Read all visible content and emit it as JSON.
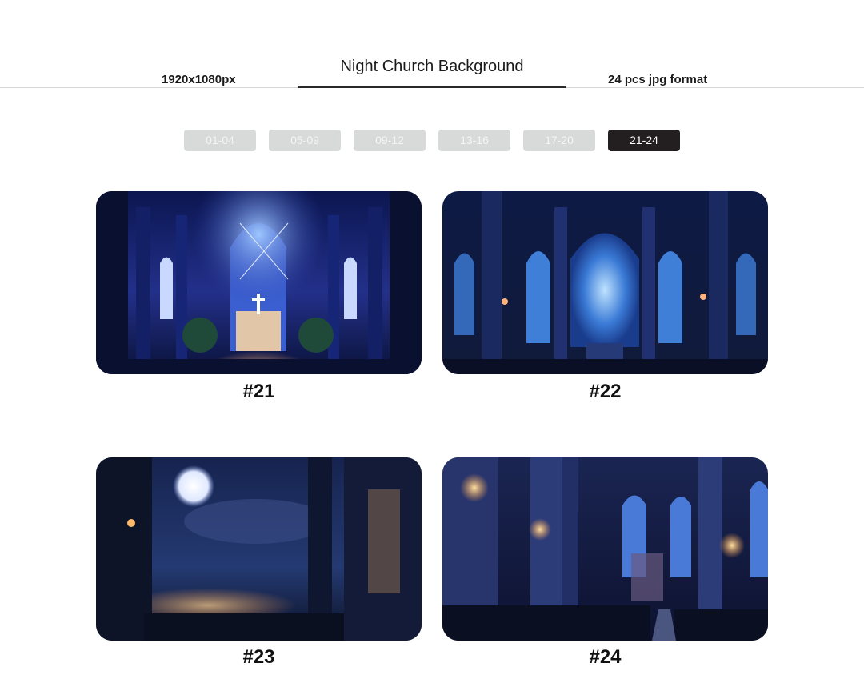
{
  "header": {
    "resolution": "1920x1080px",
    "title": "Night Church Background",
    "format": "24 pcs jpg format"
  },
  "tabs": [
    {
      "label": "01-04",
      "active": false
    },
    {
      "label": "05-09",
      "active": false
    },
    {
      "label": "09-12",
      "active": false
    },
    {
      "label": "13-16",
      "active": false
    },
    {
      "label": "17-20",
      "active": false
    },
    {
      "label": "21-24",
      "active": true
    }
  ],
  "gallery": [
    {
      "label": "#21",
      "image": "church-altar-night-image"
    },
    {
      "label": "#22",
      "image": "church-stained-glass-night-image"
    },
    {
      "label": "#23",
      "image": "moonlit-forest-church-image"
    },
    {
      "label": "#24",
      "image": "church-nave-lanterns-image"
    }
  ],
  "colors": {
    "tab_inactive": "#d8dada",
    "tab_active": "#231f20",
    "accent_night_blue": "#1c2a6b"
  }
}
